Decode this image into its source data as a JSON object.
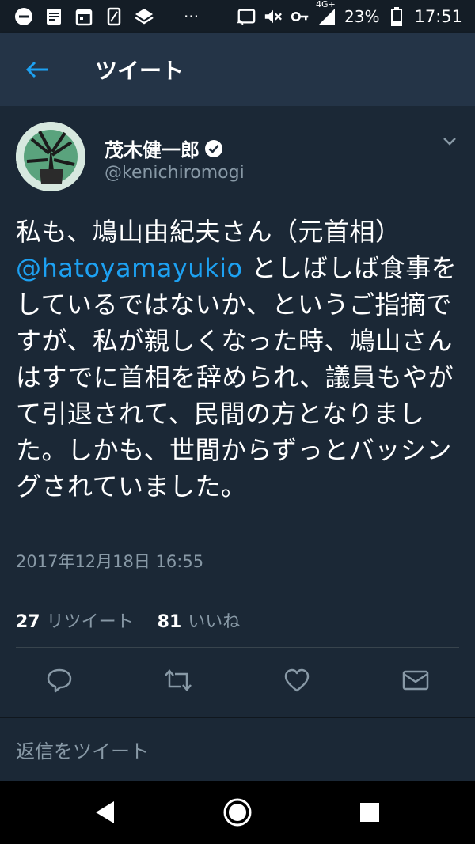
{
  "status_bar": {
    "network": "4G+",
    "battery": "23%",
    "time": "17:51",
    "icons": [
      "minus-circle-icon",
      "notes-icon",
      "calendar-icon",
      "sim-icon",
      "layers-icon",
      "more-icon",
      "cast-icon",
      "mute-icon",
      "vpn-key-icon",
      "signal-icon",
      "battery-icon"
    ],
    "more": "···"
  },
  "appbar": {
    "title": "ツイート"
  },
  "tweet": {
    "author_name": "茂木健一郎",
    "author_handle": "@kenichiromogi",
    "text_before_mention": "私も、鳩山由紀夫さん（元首相）\n",
    "mention": "@hatoyamayukio",
    "text_after_mention": " としばしば食事をしているではないか、というご指摘ですが、私が親しくなった時、鳩山さんはすでに首相を辞められ、議員もやがて引退されて、民間の方となりました。しかも、世間からずっとバッシングされていました。",
    "timestamp": "2017年12月18日 16:55",
    "retweet_count": "27",
    "retweet_label": "リツイート",
    "like_count": "81",
    "like_label": "いいね"
  },
  "reply": {
    "placeholder": "返信をツイート"
  },
  "colors": {
    "background": "#1b2836",
    "appbar": "#243447",
    "accent": "#1da1f2",
    "muted": "#8899a6",
    "verified": "#ffffff"
  }
}
